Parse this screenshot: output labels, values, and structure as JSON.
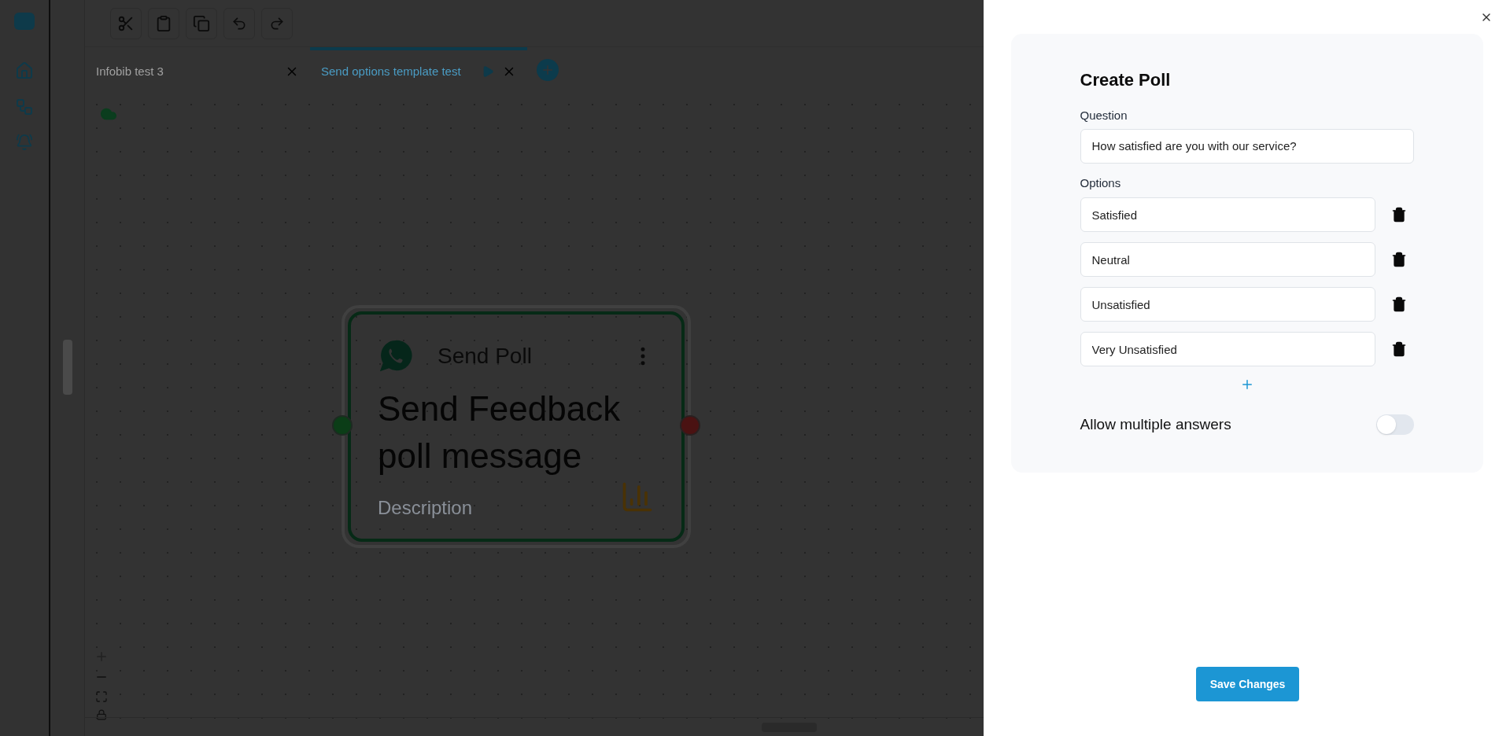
{
  "tabs": [
    {
      "label": "Infobib test 3",
      "selected": false
    },
    {
      "label": "Send options template test",
      "selected": true
    }
  ],
  "node": {
    "type": "Send Poll",
    "title": "Send Feedback poll message",
    "description": "Description"
  },
  "drawer": {
    "title": "Create Poll",
    "question_label": "Question",
    "question": "How satisfied are you with our service?",
    "options_label": "Options",
    "options": [
      "Satisfied",
      "Neutral",
      "Unsatisfied",
      "Very Unsatisfied"
    ],
    "toggle_label": "Allow multiple answers",
    "toggle_on": false,
    "save_button": "Save Changes"
  }
}
